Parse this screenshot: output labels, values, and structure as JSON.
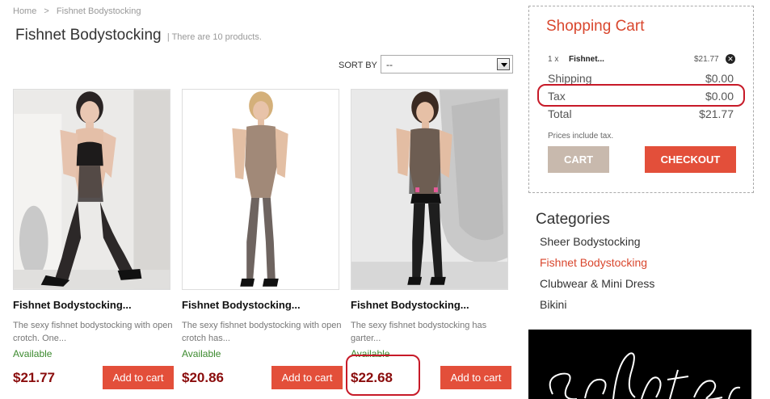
{
  "breadcrumb": {
    "home": "Home",
    "separator": ">",
    "current": "Fishnet Bodystocking"
  },
  "category": {
    "title": "Fishnet Bodystocking",
    "count_text": "| There are 10 products."
  },
  "sort": {
    "label": "SORT BY",
    "selected": "--"
  },
  "products": [
    {
      "name": "Fishnet Bodystocking...",
      "description": "The sexy fishnet bodystocking with open crotch. One...",
      "availability": "Available",
      "price": "$21.77",
      "button": "Add to cart"
    },
    {
      "name": "Fishnet Bodystocking...",
      "description": "The sexy fishnet bodystocking with open crotch has...",
      "availability": "Available",
      "price": "$20.86",
      "button": "Add to cart"
    },
    {
      "name": "Fishnet Bodystocking...",
      "description": "The sexy fishnet bodystocking has garter...",
      "availability": "Available",
      "price": "$22.68",
      "button": "Add to cart"
    }
  ],
  "cart": {
    "title": "Shopping Cart",
    "item": {
      "qty": "1 x",
      "name": "Fishnet...",
      "price": "$21.77"
    },
    "shipping_label": "Shipping",
    "shipping_value": "$0.00",
    "tax_label": "Tax",
    "tax_value": "$0.00",
    "total_label": "Total",
    "total_value": "$21.77",
    "tax_note": "Prices include tax.",
    "cart_button": "CART",
    "checkout_button": "CHECKOUT"
  },
  "categories": {
    "title": "Categories",
    "items": [
      "Sheer Bodystocking",
      "Fishnet Bodystocking",
      "Clubwear & Mini Dress",
      "Bikini"
    ],
    "active_index": 1
  },
  "colors": {
    "accent": "#e34f3a",
    "price": "#8a0c0c",
    "available": "#3c8a2e",
    "annotation": "#c71a28"
  }
}
